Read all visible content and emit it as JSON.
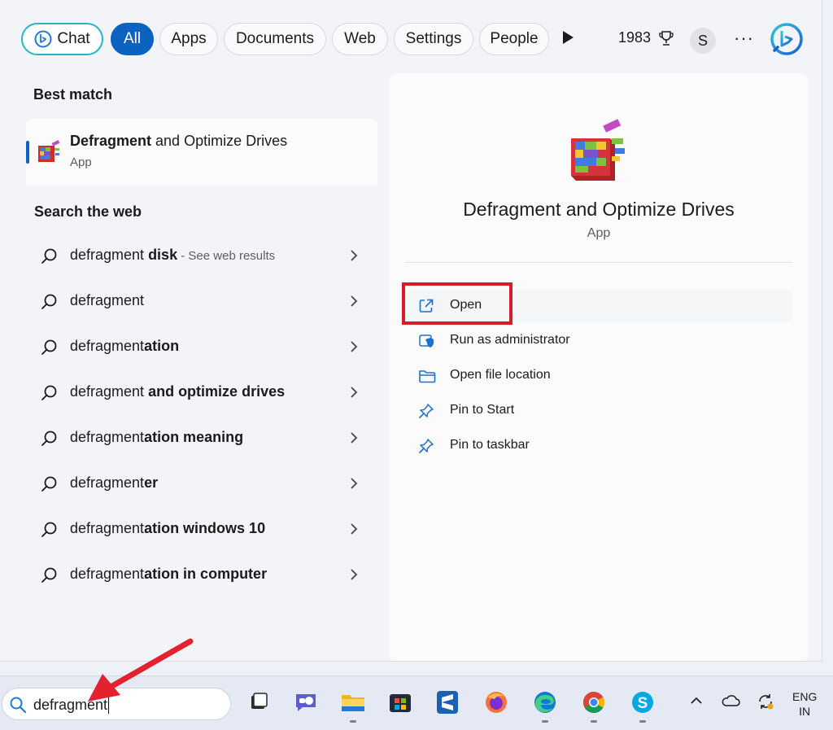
{
  "filters": {
    "chat": "Chat",
    "all": "All",
    "apps": "Apps",
    "documents": "Documents",
    "web": "Web",
    "settings": "Settings",
    "people": "People",
    "points": "1983",
    "avatar_initial": "S",
    "more": "···"
  },
  "best_match": {
    "heading": "Best match",
    "name_bold": "Defragment",
    "name_rest": " and Optimize Drives",
    "type": "App",
    "icon": "disk-defragmenter-icon"
  },
  "web_search": {
    "heading": "Search the web",
    "results": [
      {
        "plain": "defragment",
        "bold": " disk",
        "sub": " - See web results"
      },
      {
        "plain": "defragment",
        "bold": "",
        "sub": ""
      },
      {
        "plain": "defragment",
        "bold": "ation",
        "sub": ""
      },
      {
        "plain": "defragment",
        "bold": " and optimize drives",
        "sub": ""
      },
      {
        "plain": "defragment",
        "bold": "ation meaning",
        "sub": ""
      },
      {
        "plain": "defragment",
        "bold": "er",
        "sub": ""
      },
      {
        "plain": "defragment",
        "bold": "ation windows 10",
        "sub": ""
      },
      {
        "plain": "defragment",
        "bold": "ation in computer",
        "sub": ""
      }
    ]
  },
  "preview": {
    "app_name": "Defragment and Optimize Drives",
    "app_type": "App",
    "actions": [
      {
        "label": "Open",
        "icon": "open-external-icon"
      },
      {
        "label": "Run as administrator",
        "icon": "shield-admin-icon"
      },
      {
        "label": "Open file location",
        "icon": "folder-icon"
      },
      {
        "label": "Pin to Start",
        "icon": "pin-icon"
      },
      {
        "label": "Pin to taskbar",
        "icon": "pin-icon"
      }
    ]
  },
  "taskbar": {
    "search_value": "defragment",
    "apps": [
      "task-view",
      "teams-chat",
      "file-explorer",
      "microsoft-store",
      "sublime-text",
      "firefox",
      "edge",
      "chrome",
      "skype"
    ],
    "lang_top": "ENG",
    "lang_bottom": "IN"
  },
  "colors": {
    "accent": "#0b62c0",
    "highlight_box": "#d71b2a",
    "chat_border": "#27b4c9"
  }
}
